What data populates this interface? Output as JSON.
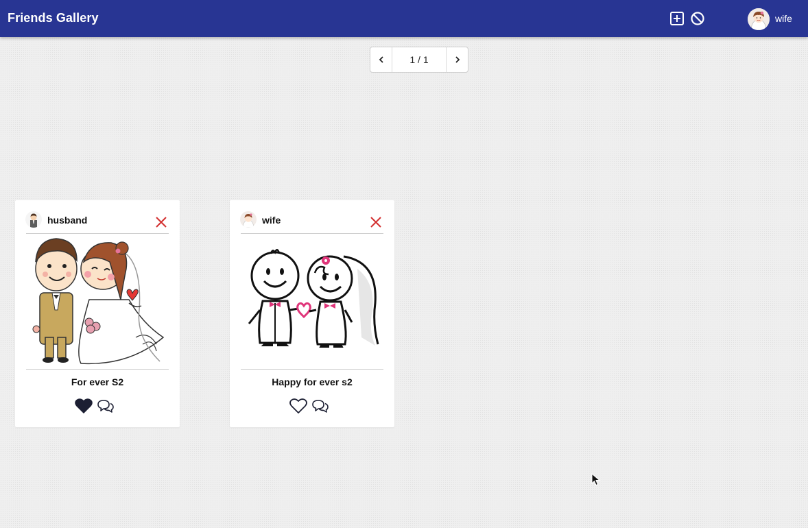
{
  "app": {
    "title": "Friends Gallery"
  },
  "toolbar": {
    "add_icon": "plus-square-icon",
    "block_icon": "block-icon",
    "user": {
      "name": "wife",
      "avatar": "bride-avatar"
    }
  },
  "pagination": {
    "label": "1 / 1",
    "prev_icon": "chevron-left-icon",
    "next_icon": "chevron-right-icon"
  },
  "posts": [
    {
      "author": "husband",
      "avatar": "groom-avatar",
      "caption": "For ever S2",
      "image": "cartoon-bride-and-groom",
      "liked": true
    },
    {
      "author": "wife",
      "avatar": "bride-avatar",
      "caption": "Happy for ever s2",
      "image": "stick-figure-couple",
      "liked": false
    }
  ],
  "colors": {
    "header": "#283593",
    "delete": "#d32f2f",
    "heart_pink": "#e0357a"
  }
}
